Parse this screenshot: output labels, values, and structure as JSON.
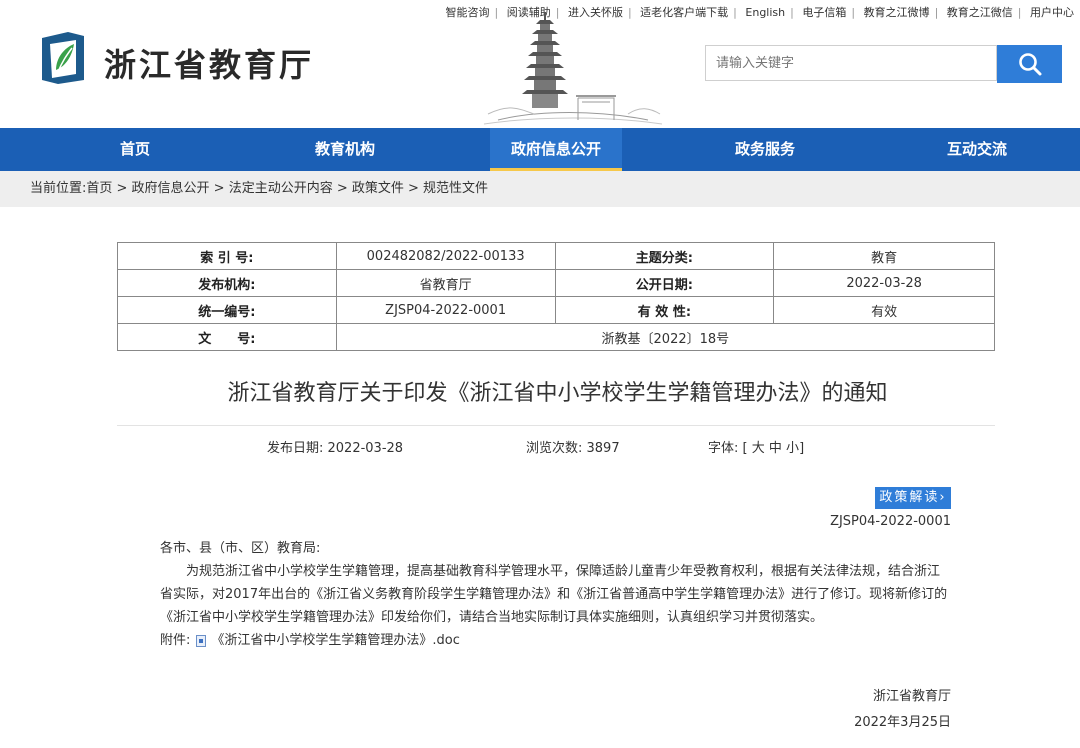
{
  "top_links": [
    "智能咨询",
    "阅读辅助",
    "进入关怀版",
    "适老化客户端下载",
    "English",
    "电子信箱",
    "教育之江微博",
    "教育之江微信",
    "用户中心"
  ],
  "site_name": "浙江省教育厅",
  "search": {
    "placeholder": "请输入关键字"
  },
  "nav": [
    {
      "label": "首页"
    },
    {
      "label": "教育机构"
    },
    {
      "label": "政府信息公开",
      "active": true
    },
    {
      "label": "政务服务"
    },
    {
      "label": "互动交流"
    }
  ],
  "breadcrumb": "当前位置:首页 > 政府信息公开 > 法定主动公开内容 > 政策文件 > 规范性文件",
  "meta": {
    "index_label": "索 引 号:",
    "index_value": "002482082/2022-00133",
    "topic_label": "主题分类:",
    "topic_value": "教育",
    "publisher_label": "发布机构:",
    "publisher_value": "省教育厅",
    "pubdate_label": "公开日期:",
    "pubdate_value": "2022-03-28",
    "code_label": "统一编号:",
    "code_value": "ZJSP04-2022-0001",
    "validity_label": "有 效 性:",
    "validity_value": "有效",
    "docnum_label": "文　　号:",
    "docnum_value": "浙教基〔2022〕18号"
  },
  "title": "浙江省教育厅关于印发《浙江省中小学校学生学籍管理办法》的通知",
  "info": {
    "date": "发布日期: 2022-03-28",
    "views": "浏览次数: 3897",
    "font_label": "字体: [",
    "font_large": "大",
    "font_medium": "中",
    "font_small": "小",
    "font_end": "]"
  },
  "policy_button": "政策解读",
  "doc_code": "ZJSP04-2022-0001",
  "body": {
    "salutation": "各市、县（市、区）教育局:",
    "paragraph": "为规范浙江省中小学校学生学籍管理，提高基础教育科学管理水平，保障适龄儿童青少年受教育权利，根据有关法律法规，结合浙江省实际，对2017年出台的《浙江省义务教育阶段学生学籍管理办法》和《浙江省普通高中学生学籍管理办法》进行了修订。现将新修订的《浙江省中小学校学生学籍管理办法》印发给你们，请结合当地实际制订具体实施细则，认真组织学习并贯彻落实。",
    "attachment_label": "附件:",
    "attachment_name": "《浙江省中小学校学生学籍管理办法》.doc"
  },
  "signature": {
    "org": "浙江省教育厅",
    "date": "2022年3月25日"
  },
  "colors": {
    "nav_bg": "#1b5fb5",
    "nav_active": "#2a73cb",
    "accent": "#2f7dd8",
    "active_underline": "#f6c84a"
  }
}
